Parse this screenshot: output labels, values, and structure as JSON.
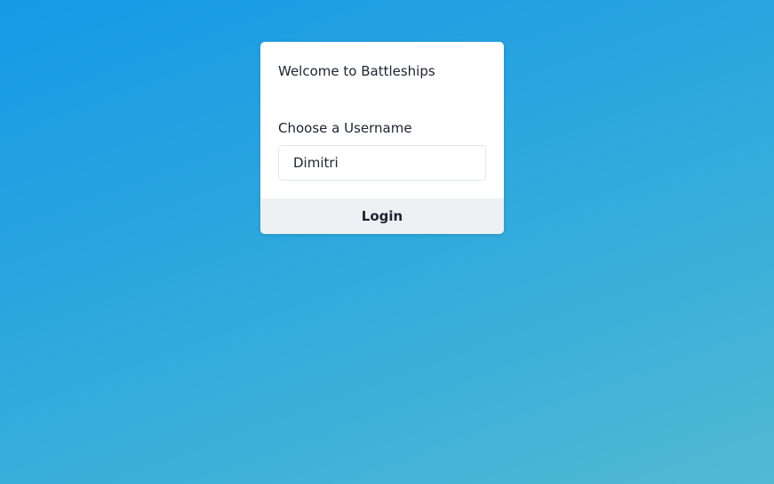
{
  "login_card": {
    "welcome_text": "Welcome to Battleships",
    "username_label": "Choose a Username",
    "username_value": "Dimitri",
    "login_label": "Login"
  },
  "colors": {
    "background_start": "#169ae6",
    "background_end": "#52b9d3",
    "card": "#ffffff",
    "button_bg": "#edf1f4",
    "text": "#1f2330"
  }
}
